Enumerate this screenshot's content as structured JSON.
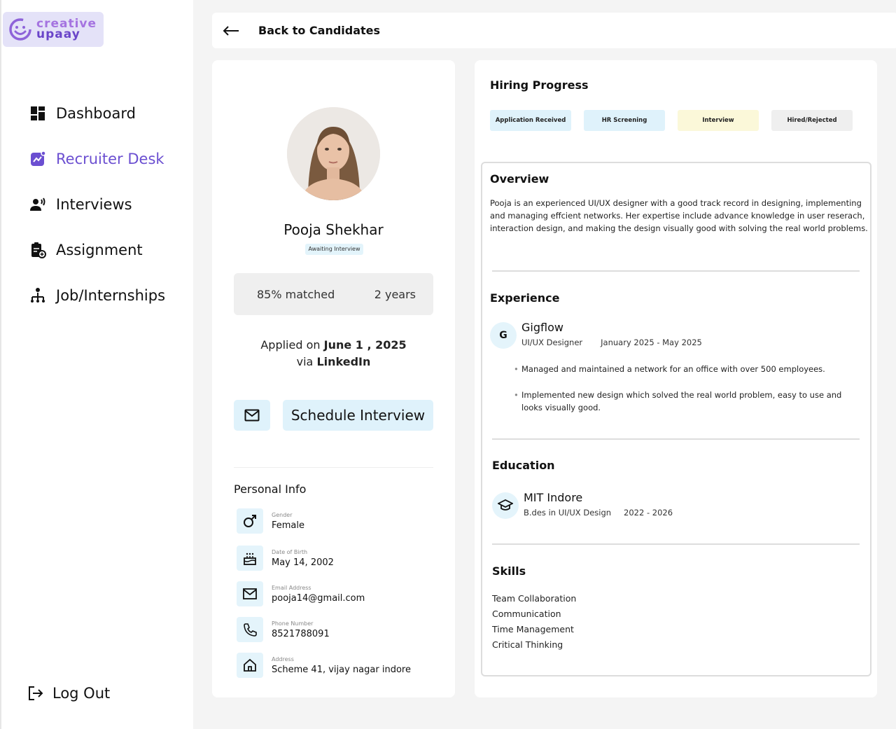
{
  "brand": {
    "line1": "creative",
    "line2": "upaay"
  },
  "sidebar": {
    "items": [
      {
        "label": "Dashboard",
        "icon": "dashboard-icon"
      },
      {
        "label": "Recruiter Desk",
        "icon": "recruiter-icon",
        "active": true
      },
      {
        "label": "Interviews",
        "icon": "interviews-icon"
      },
      {
        "label": "Assignment",
        "icon": "assignment-icon"
      },
      {
        "label": "Job/Internships",
        "icon": "jobs-icon"
      }
    ],
    "logout": "Log Out"
  },
  "topbar": {
    "back_label": "Back to Candidates"
  },
  "candidate": {
    "name": "Pooja Shekhar",
    "status": "Awaiting Interview",
    "match": "85% matched",
    "experience_years": "2 years",
    "applied_prefix": "Applied on",
    "applied_date": "June 1 , 2025",
    "via_prefix": "via",
    "source": "LinkedIn",
    "schedule_label": "Schedule Interview"
  },
  "personal_info": {
    "title": "Personal Info",
    "fields": [
      {
        "label": "Gender",
        "value": "Female",
        "icon": "gender-icon"
      },
      {
        "label": "Date of Birth",
        "value": "May 14, 2002",
        "icon": "cake-icon"
      },
      {
        "label": "Email Address",
        "value": "pooja14@gmail.com",
        "icon": "mail-icon"
      },
      {
        "label": "Phone Number",
        "value": "8521788091",
        "icon": "phone-icon"
      },
      {
        "label": "Address",
        "value": "Scheme 41, vijay nagar indore",
        "icon": "home-icon"
      }
    ]
  },
  "hiring": {
    "title": "Hiring Progress",
    "stages": [
      {
        "label": "Application Received",
        "color": "#dff2fb"
      },
      {
        "label": "HR Screening",
        "color": "#dff2fb"
      },
      {
        "label": "Interview",
        "color": "#fbf8d9"
      },
      {
        "label": "Hired/Rejected",
        "color": "#efefef"
      }
    ]
  },
  "overview": {
    "title": "Overview",
    "text": "Pooja is an experienced UI/UX designer with a good track record in designing, implementing and managing effcient networks. Her expertise include advance knowledge in user reserach, interaction design, and making the design visually good with solving the real world problems."
  },
  "experience": {
    "title": "Experience",
    "company": "Gigflow",
    "initial": "G",
    "role": "UI/UX Designer",
    "period": "January 2025 - May 2025",
    "bullets": [
      "Managed and maintained a network for an office with over 500 employees.",
      "Implemented new design which solved the real world problem, easy to use and looks visually good."
    ]
  },
  "education": {
    "title": "Education",
    "school": "MIT Indore",
    "degree": "B.des in UI/UX Design",
    "period": "2022 - 2026"
  },
  "skills": {
    "title": "Skills",
    "items": [
      "Team Collaboration",
      "Communication",
      "Time Management",
      "Critical Thinking"
    ]
  }
}
